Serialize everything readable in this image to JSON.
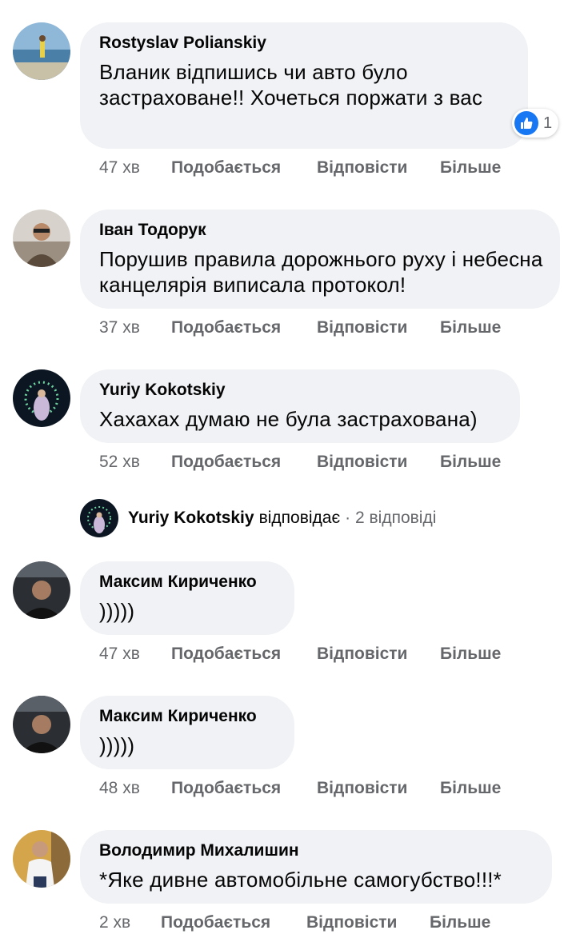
{
  "comments": [
    {
      "author": "Rostyslav Polianskiy",
      "text": "Вланик відпишись чи авто було застраховане!! Хочеться поржати з вас",
      "time": "47 хв",
      "like": "Подобається",
      "reply": "Відповісти",
      "more": "Більше",
      "reactions": "1"
    },
    {
      "author": "Іван Тодорук",
      "text": "Порушив правила дорожнього руху і небесна канцелярія виписала протокол!",
      "time": "37 хв",
      "like": "Подобається",
      "reply": "Відповісти",
      "more": "Більше"
    },
    {
      "author": "Yuriy Kokotskiy",
      "text": "Хахахах думаю не була застрахована)",
      "time": "52 хв",
      "like": "Подобається",
      "reply": "Відповісти",
      "more": "Більше"
    },
    {
      "author": "Максим Кириченко",
      "text": ")))))",
      "time": "47 хв",
      "like": "Подобається",
      "reply": "Відповісти",
      "more": "Більше"
    },
    {
      "author": "Максим Кириченко",
      "text": ")))))",
      "time": "48 хв",
      "like": "Подобається",
      "reply": "Відповісти",
      "more": "Більше"
    },
    {
      "author": "Володимир Михалишин",
      "text": "*Яке дивне автомобільне самогубство!!!*",
      "time": "2 хв",
      "like": "Подобається",
      "reply": "Відповісти",
      "more": "Більше"
    }
  ],
  "reply_summary": {
    "author": "Yuriy Kokotskiy",
    "verb": "відповідає",
    "count": "· 2 відповіді"
  },
  "colors": {
    "bubble": "#f0f2f5",
    "meta": "#65676b",
    "like": "#1877f2"
  }
}
